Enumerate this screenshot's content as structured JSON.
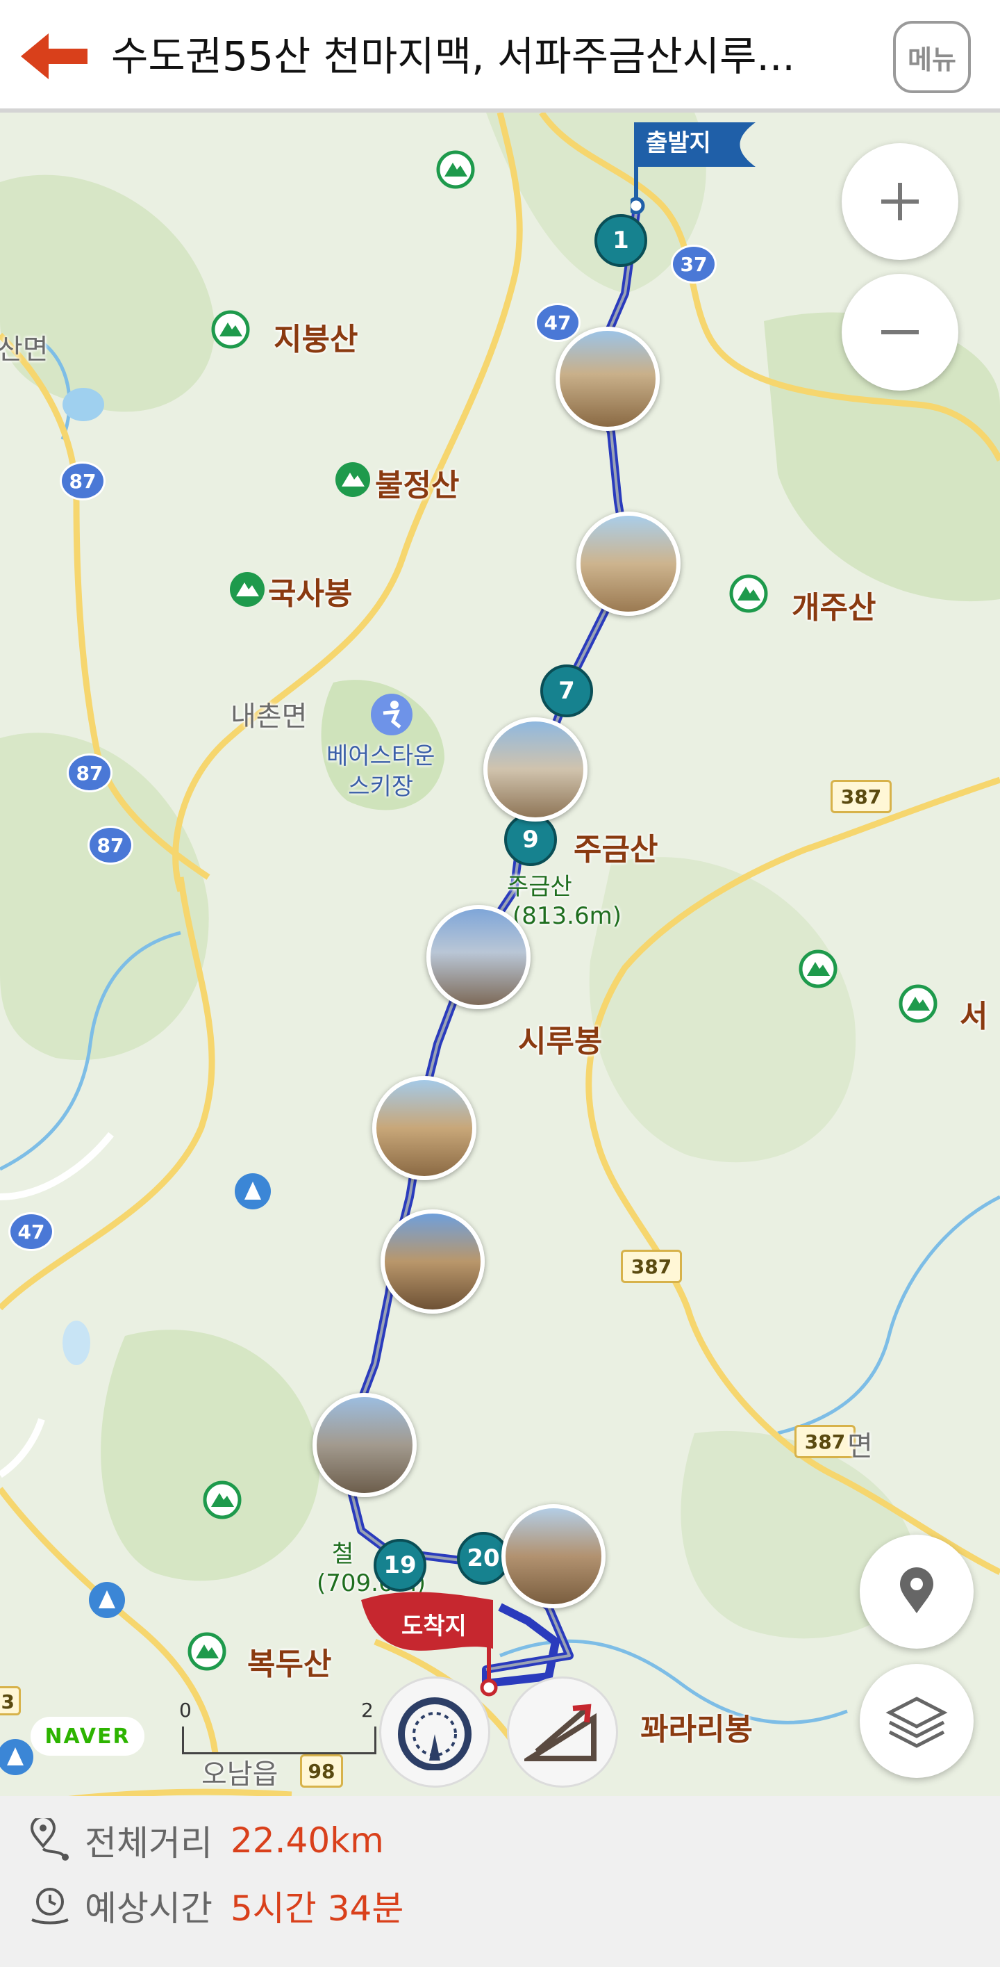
{
  "header": {
    "title": "수도권55산  천마지맥, 서파주금산시루...",
    "menu_label": "메뉴"
  },
  "map": {
    "markers": {
      "start": "출발지",
      "end": "도착지",
      "waypoints": [
        "1",
        "7",
        "9",
        "19",
        "20"
      ]
    },
    "mountains": [
      "지붕산",
      "불정산",
      "국사봉",
      "개주산",
      "주금산",
      "시루봉",
      "복두산",
      "꽈라리봉",
      "서"
    ],
    "places": [
      "내촌면",
      "산면",
      "오남읍",
      "면"
    ],
    "ski_resort": "베어스타운\n스키장",
    "peak_detail": {
      "name": "주금산",
      "elevation": "(813.6m)",
      "other_name": "철",
      "other_elevation": "(709.6m)"
    },
    "road_numbers": [
      "37",
      "47",
      "87",
      "87",
      "87",
      "387",
      "387",
      "387",
      "47",
      "98",
      "3"
    ],
    "scale": {
      "start": "0",
      "end": "2"
    },
    "brand": "NAVER"
  },
  "footer": {
    "distance_label": "전체거리",
    "distance_value": "22.40km",
    "time_label": "예상시간",
    "time_value": "5시간 34분"
  },
  "colors": {
    "accent": "#d9401b",
    "route": "#2a3bbd",
    "waypoint": "#16828f",
    "start_flag": "#1f5fa8",
    "end_flag": "#c6272f"
  }
}
